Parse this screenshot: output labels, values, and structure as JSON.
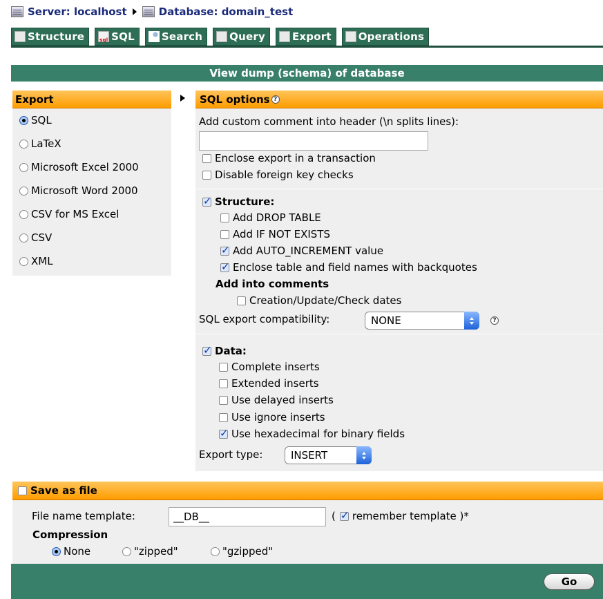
{
  "breadcrumb": {
    "server": "Server: localhost",
    "database": "Database: domain_test"
  },
  "tabs": [
    {
      "label": "Structure",
      "icon": "structure-icon"
    },
    {
      "label": "SQL",
      "icon": "sql-icon"
    },
    {
      "label": "Search",
      "icon": "search-icon"
    },
    {
      "label": "Query",
      "icon": "query-icon"
    },
    {
      "label": "Export",
      "icon": "export-icon"
    },
    {
      "label": "Operations",
      "icon": "operations-icon"
    }
  ],
  "main_title": "View dump (schema) of database",
  "export": {
    "heading": "Export",
    "selected": "SQL",
    "formats": [
      "SQL",
      "LaTeX",
      "Microsoft Excel 2000",
      "Microsoft Word 2000",
      "CSV for MS Excel",
      "CSV",
      "XML"
    ]
  },
  "sql_options": {
    "heading": "SQL options",
    "comment_label": "Add custom comment into header (\\n splits lines):",
    "comment_value": "",
    "enclose_transaction": {
      "label": "Enclose export in a transaction",
      "checked": false
    },
    "disable_fk": {
      "label": "Disable foreign key checks",
      "checked": false
    },
    "structure": {
      "label": "Structure:",
      "checked": true,
      "drop_table": {
        "label": "Add DROP TABLE",
        "checked": false
      },
      "if_not_exists": {
        "label": "Add IF NOT EXISTS",
        "checked": false
      },
      "auto_increment": {
        "label": "Add AUTO_INCREMENT value",
        "checked": true
      },
      "backquotes": {
        "label": "Enclose table and field names with backquotes",
        "checked": true
      },
      "comments_heading": "Add into comments",
      "dates": {
        "label": "Creation/Update/Check dates",
        "checked": false
      },
      "compat_label": "SQL export compatibility:",
      "compat_value": "NONE"
    },
    "data": {
      "label": "Data:",
      "checked": true,
      "complete": {
        "label": "Complete inserts",
        "checked": false
      },
      "extended": {
        "label": "Extended inserts",
        "checked": false
      },
      "delayed": {
        "label": "Use delayed inserts",
        "checked": false
      },
      "ignore": {
        "label": "Use ignore inserts",
        "checked": false
      },
      "hex": {
        "label": "Use hexadecimal for binary fields",
        "checked": true
      },
      "type_label": "Export type:",
      "type_value": "INSERT"
    }
  },
  "save": {
    "label": "Save as file",
    "checked": false,
    "template_label": "File name template:",
    "template_value": "__DB__",
    "open_paren": "(",
    "remember_label": "remember template )*",
    "remember_checked": true,
    "compression_heading": "Compression",
    "compression_options": [
      "None",
      "\"zipped\"",
      "\"gzipped\""
    ],
    "compression_selected": "None"
  },
  "go_label": "Go",
  "colors": {
    "tab_green": "#2e6e56",
    "bar_green": "#38806a",
    "header_orange": "#ff9c00",
    "panel_gray": "#efefef"
  }
}
